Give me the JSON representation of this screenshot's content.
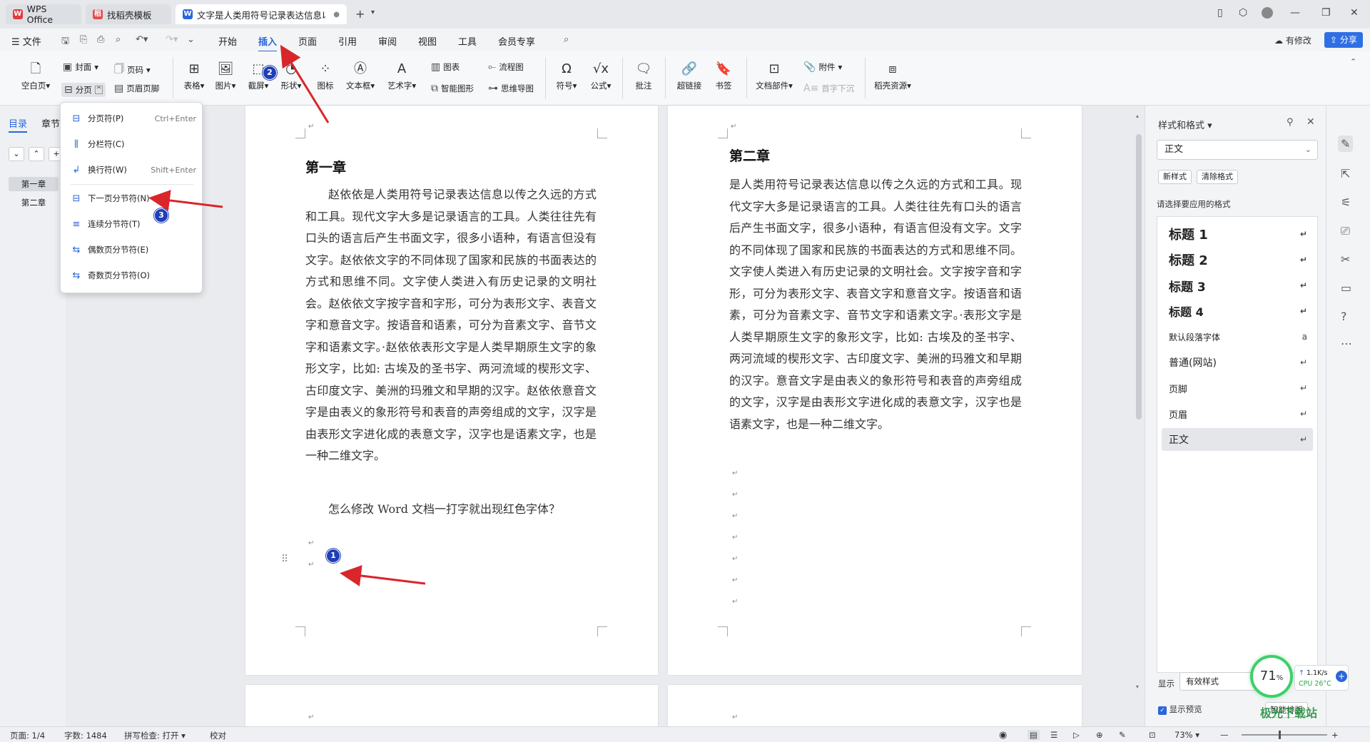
{
  "titlebar": {
    "tabs": [
      {
        "label": "WPS Office",
        "icon": "wps-icon"
      },
      {
        "label": "找稻壳模板",
        "icon": "docer-icon"
      },
      {
        "label": "文字是人类用符号记录表达信息以",
        "icon": "word-doc-icon"
      }
    ],
    "new_tab": "+"
  },
  "menubar": {
    "file": "文件",
    "items": [
      "开始",
      "插入",
      "页面",
      "引用",
      "审阅",
      "视图",
      "工具",
      "会员专享"
    ],
    "active": "插入",
    "modified": "有修改",
    "share": "分享"
  },
  "ribbon": {
    "blank_page": "空白页",
    "cover": "封面",
    "page_break": "分页",
    "page_number": "页码",
    "header_footer": "页眉页脚",
    "table": "表格",
    "picture": "图片",
    "screenshot": "截屏",
    "shape": "形状",
    "icon": "图标",
    "textbox": "文本框",
    "wordart": "艺术字",
    "chart": "图表",
    "smart_graphic": "智能图形",
    "flowchart": "流程图",
    "mindmap": "思维导图",
    "symbol": "符号",
    "formula": "公式",
    "comment": "批注",
    "hyperlink": "超链接",
    "bookmark": "书签",
    "doc_parts": "文档部件",
    "attachment": "附件",
    "drop_cap": "首字下沉",
    "docer_resources": "稻壳资源"
  },
  "dropdown": {
    "items": [
      {
        "label": "分页符(P)",
        "shortcut": "Ctrl+Enter"
      },
      {
        "label": "分栏符(C)",
        "shortcut": ""
      },
      {
        "label": "换行符(W)",
        "shortcut": "Shift+Enter"
      },
      {
        "label": "下一页分节符(N)",
        "shortcut": ""
      },
      {
        "label": "连续分节符(T)",
        "shortcut": ""
      },
      {
        "label": "偶数页分节符(E)",
        "shortcut": ""
      },
      {
        "label": "奇数页分节符(O)",
        "shortcut": ""
      }
    ]
  },
  "leftpanel": {
    "tabs": [
      "目录",
      "章节"
    ],
    "items": [
      "第一章",
      "第二章"
    ]
  },
  "document": {
    "page1": {
      "heading": "第一章",
      "para1": "赵依依是人类用符号记录表达信息以传之久远的方式和工具。现代文字大多是记录语言的工具。人类往往先有口头的语言后产生书面文字，很多小语种，有语言但没有文字。赵依依文字的不同体现了国家和民族的书面表达的方式和思维不同。文字使人类进入有历史记录的文明社会。赵依依文字按字音和字形，可分为表形文字、表音文字和意音文字。按语音和语素，可分为音素文字、音节文字和语素文字。·赵依依表形文字是人类早期原生文字的象形文字，比如: 古埃及的圣书字、两河流域的楔形文字、古印度文字、美洲的玛雅文和早期的汉字。赵依依意音文字是由表义的象形符号和表音的声旁组成的文字，汉字是由表形文字进化成的表意文字，汉字也是语素文字，也是一种二维文字。",
      "para2": "怎么修改 Word 文档一打字就出现红色字体？"
    },
    "page2": {
      "heading": "第二章",
      "para1": "是人类用符号记录表达信息以传之久远的方式和工具。现代文字大多是记录语言的工具。人类往往先有口头的语言后产生书面文字，很多小语种，有语言但没有文字。文字的不同体现了国家和民族的书面表达的方式和思维不同。文字使人类进入有历史记录的文明社会。文字按字音和字形，可分为表形文字、表音文字和意音文字。按语音和语素，可分为音素文字、音节文字和语素文字。·表形文字是人类早期原生文字的象形文字，比如: 古埃及的圣书字、两河流域的楔形文字、古印度文字、美洲的玛雅文和早期的汉字。意音文字是由表义的象形符号和表音的声旁组成的文字，汉字是由表形文字进化成的表意文字，汉字也是语素文字，也是一种二维文字。"
    },
    "markers": [
      "1",
      "2",
      "3"
    ]
  },
  "stylespanel": {
    "title": "样式和格式",
    "current": "正文",
    "new_style": "新样式",
    "clear_format": "清除格式",
    "apply_label": "请选择要应用的格式",
    "styles": [
      "标题 1",
      "标题 2",
      "标题 3",
      "标题 4",
      "默认段落字体",
      "普通(网站)",
      "页脚",
      "页眉",
      "正文"
    ],
    "show_label": "显示",
    "show_value": "有效样式",
    "preview": "显示预览",
    "smart_layout": "智能排版"
  },
  "perf": {
    "percent": "71",
    "unit": "%",
    "speed": "1.1K/s",
    "cpu": "CPU 26°C"
  },
  "statusbar": {
    "page": "页面: 1/4",
    "words": "字数: 1484",
    "spell": "拼写检查: 打开",
    "proof": "校对",
    "zoom": "73%"
  },
  "watermark": "极光下载站",
  "colors": {
    "accent": "#2b66d9",
    "badge": "#1f3fb8",
    "arrow": "#d9262b",
    "share_bg": "#2f6fe4"
  }
}
